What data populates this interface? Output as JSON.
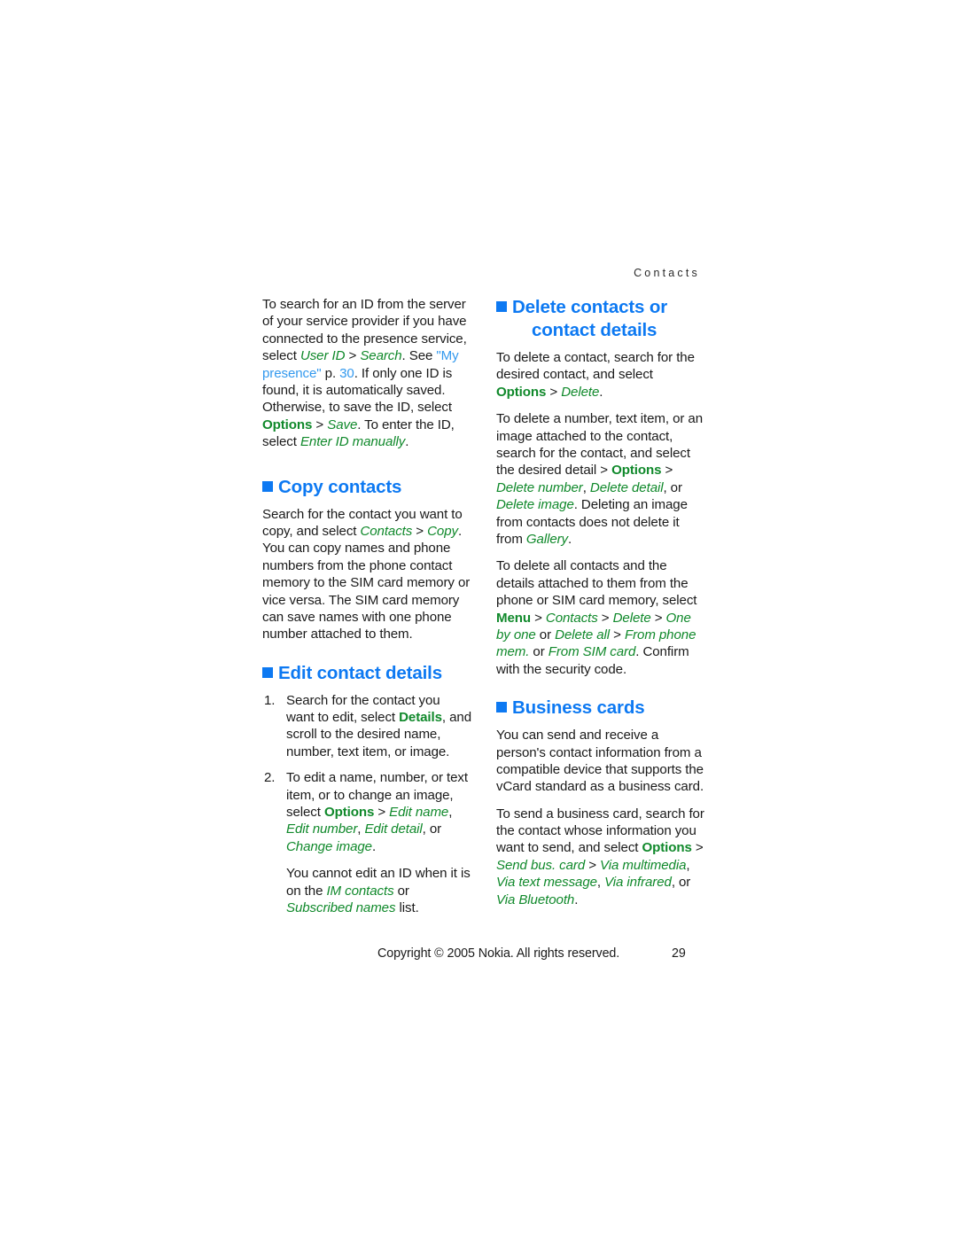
{
  "page": {
    "running_head": "Contacts",
    "page_number": "29",
    "copyright": "Copyright © 2005 Nokia. All rights reserved.",
    "heading_color": "#0d79f2",
    "keyword_color": "#10892b",
    "link_color": "#3399ee",
    "body_color": "#1a1a1a"
  },
  "left_column": {
    "intro_paragraph": {
      "part1": "To search for an ID from the server of your service provider if you have connected to the presence service, select ",
      "kw1": "User ID",
      "sep1": " > ",
      "kw2": "Search",
      "part2": ". See ",
      "link1": "\"My presence\"",
      "part3": " p. ",
      "link2": "30",
      "part4": ". If only one ID is found, it is automatically saved. Otherwise, to save the ID, select ",
      "kw3": "Options",
      "sep2": " > ",
      "kw4": "Save",
      "part5": ". To enter the ID, select ",
      "kw5": "Enter ID manually",
      "part6": "."
    },
    "copy_contacts": {
      "heading": "Copy contacts",
      "body_part1": "Search for the contact you want to copy, and select ",
      "kw1": "Contacts",
      "sep1": " > ",
      "kw2": "Copy",
      "body_part2": ". You can copy names and phone numbers from the phone contact memory to the SIM card memory or vice versa. The SIM card memory can save names with one phone number attached to them."
    },
    "edit_contact_details": {
      "heading": "Edit contact details",
      "step1_part1": "Search for the contact you want to edit, select ",
      "step1_kw1": "Details",
      "step1_part2": ", and scroll to the desired name, number, text item, or image.",
      "step2_part1": "To edit a name, number, or text item, or to change an image, select ",
      "step2_kw1": "Options",
      "step2_sep1": " > ",
      "step2_kw2": "Edit name",
      "step2_sep2": ", ",
      "step2_kw3": "Edit number",
      "step2_sep3": ", ",
      "step2_kw4": "Edit detail",
      "step2_sep4": ", or ",
      "step2_kw5": "Change image",
      "step2_part2": ".",
      "note_part1": "You cannot edit an ID when it is on the ",
      "note_kw1": "IM contacts",
      "note_part2": " or ",
      "note_kw2": "Subscribed names",
      "note_part3": " list."
    }
  },
  "right_column": {
    "delete_contacts": {
      "heading_line1": "Delete contacts or",
      "heading_line2": "contact details",
      "p1_part1": "To delete a contact, search for the desired contact, and select ",
      "p1_kw1": "Options",
      "p1_sep1": " > ",
      "p1_kw2": "Delete",
      "p1_part2": ".",
      "p2_part1": "To delete a number, text item, or an image attached to the contact, search for the contact, and select the desired detail > ",
      "p2_kw1": "Options",
      "p2_sep1": " > ",
      "p2_kw2": "Delete number",
      "p2_sep2": ", ",
      "p2_kw3": "Delete detail",
      "p2_sep3": ", or ",
      "p2_kw4": "Delete image",
      "p2_part2": ". Deleting an image from contacts does not delete it from ",
      "p2_kw5": "Gallery",
      "p2_part3": ".",
      "p3_part1": "To delete all contacts and the details attached to them from the phone or SIM card memory, select ",
      "p3_kw1": "Menu",
      "p3_sep1": " > ",
      "p3_kw2": "Contacts",
      "p3_sep2": " > ",
      "p3_kw3": "Delete",
      "p3_sep3": " > ",
      "p3_kw4": "One by one",
      "p3_sep4": " or ",
      "p3_kw5": "Delete all",
      "p3_sep5": " > ",
      "p3_kw6": "From phone mem.",
      "p3_sep6": " or ",
      "p3_kw7": "From SIM card",
      "p3_part2": ". Confirm with the security code."
    },
    "business_cards": {
      "heading": "Business cards",
      "p1": "You can send and receive a person's contact information from a compatible device that supports the vCard standard as a business card.",
      "p2_part1": "To send a business card, search for the contact whose information you want to send, and select ",
      "p2_kw1": "Options",
      "p2_sep1": " > ",
      "p2_kw2": "Send bus. card",
      "p2_sep2": " > ",
      "p2_kw3": "Via multimedia",
      "p2_sep3": ", ",
      "p2_kw4": "Via text message",
      "p2_sep4": ", ",
      "p2_kw5": "Via infrared",
      "p2_sep5": ", or ",
      "p2_kw6": "Via Bluetooth",
      "p2_part2": "."
    }
  }
}
